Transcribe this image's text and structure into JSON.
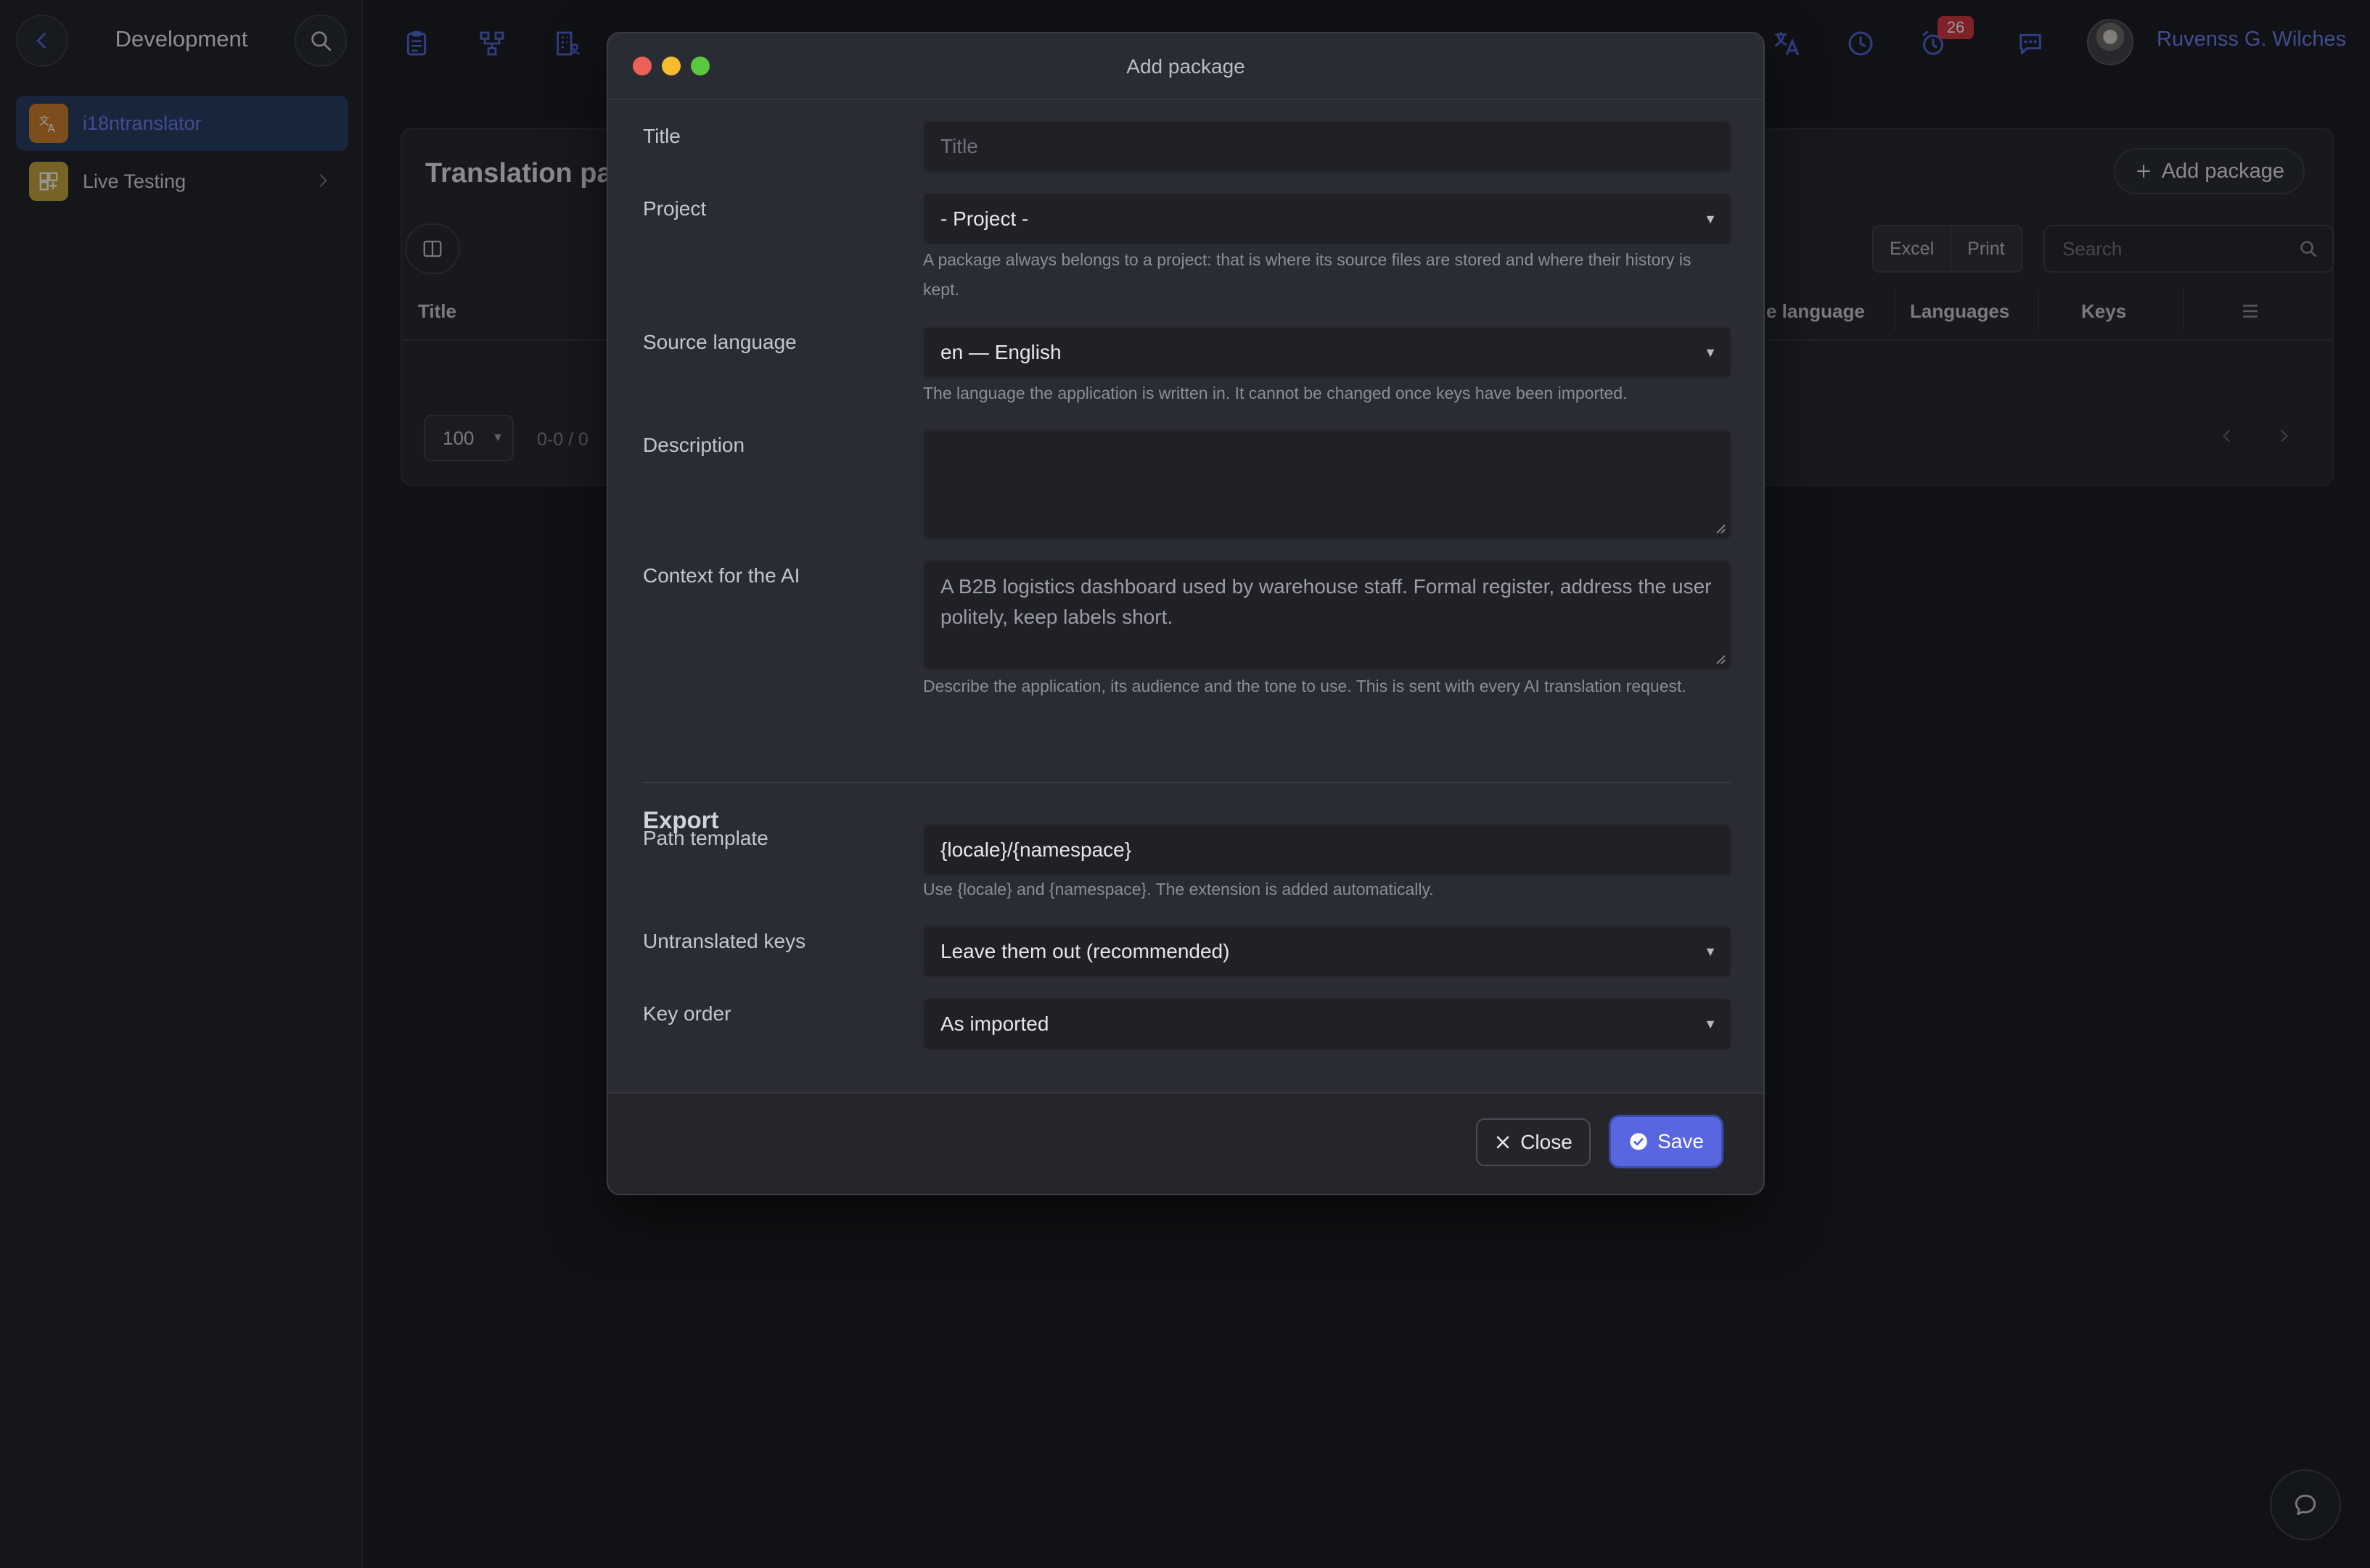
{
  "sidebar": {
    "title": "Development",
    "items": [
      {
        "label": "i18ntranslator",
        "active": true,
        "color": "#6a7cf0"
      },
      {
        "label": "Live Testing",
        "active": false
      }
    ]
  },
  "topbar": {
    "notification_count": "26",
    "user_name": "Ruvenss G. Wilches",
    "icons": [
      "clipboard-icon",
      "hierarchy-icon",
      "building-icon",
      "translate-icon",
      "clock-icon",
      "alarm-icon",
      "chat-icon"
    ]
  },
  "page": {
    "title": "Translation pac",
    "add_button": "Add package",
    "export_buttons": [
      "Excel",
      "Print"
    ],
    "search_placeholder": "Search",
    "columns": {
      "title": "Title",
      "source_language": "e language",
      "languages": "Languages",
      "keys": "Keys"
    },
    "per_page": "100",
    "range": "0-0 / 0"
  },
  "modal": {
    "title": "Add package",
    "fields": {
      "title": {
        "label": "Title",
        "placeholder": "Title",
        "value": ""
      },
      "project": {
        "label": "Project",
        "value": "- Project -",
        "help": "A package always belongs to a project: that is where its source files are stored and where their history is kept."
      },
      "source_language": {
        "label": "Source language",
        "value": "en — English",
        "help": "The language the application is written in. It cannot be changed once keys have been imported."
      },
      "description": {
        "label": "Description",
        "value": ""
      },
      "context": {
        "label": "Context for the AI",
        "value": "A B2B logistics dashboard used by warehouse staff. Formal register, address the user politely, keep labels short.",
        "help": "Describe the application, its audience and the tone to use. This is sent with every AI translation request."
      }
    },
    "export": {
      "heading": "Export",
      "path_template": {
        "label": "Path template",
        "value": "{locale}/{namespace}",
        "help": "Use {locale} and {namespace}. The extension is added automatically."
      },
      "untranslated_keys": {
        "label": "Untranslated keys",
        "value": "Leave them out (recommended)"
      },
      "key_order": {
        "label": "Key order",
        "value": "As imported"
      }
    },
    "buttons": {
      "close": "Close",
      "save": "Save"
    }
  },
  "colors": {
    "accent": "#5867e0",
    "link": "#6a7cf0",
    "badge": "#d2313b",
    "traffic_red": "#ee5f57",
    "traffic_yellow": "#f4bd2f",
    "traffic_green": "#5ac83f"
  }
}
